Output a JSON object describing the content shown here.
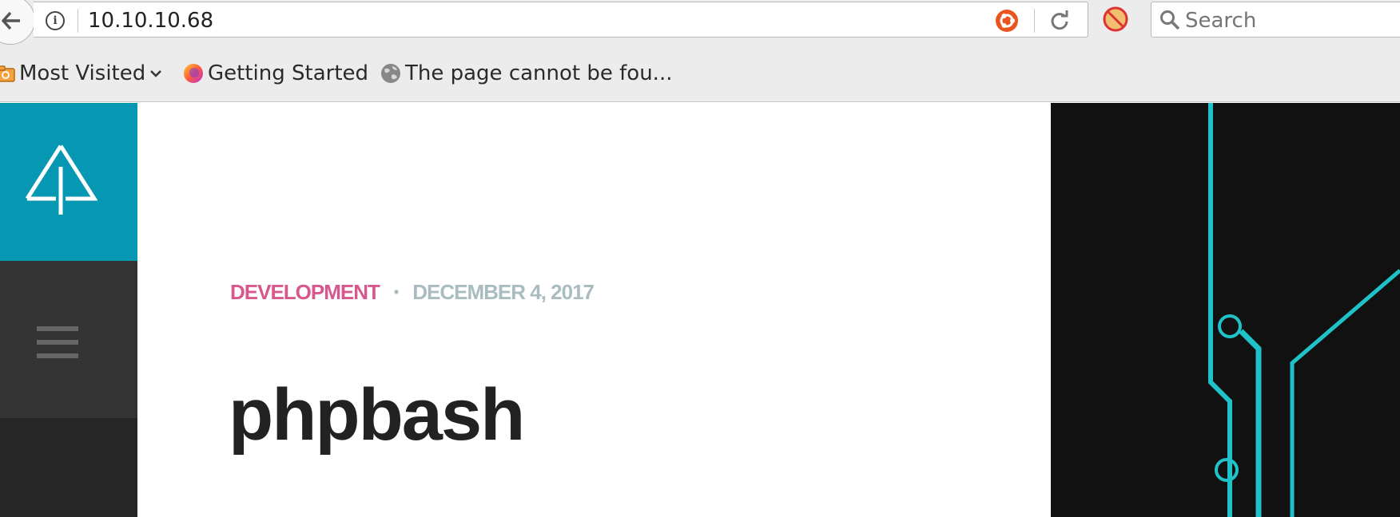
{
  "browser": {
    "url": "10.10.10.68",
    "search_placeholder": "Search",
    "bookmarks": [
      {
        "label": "Most Visited",
        "icon": "folder-icon"
      },
      {
        "label": "Getting Started",
        "icon": "firefox-icon"
      },
      {
        "label": "The page cannot be fou...",
        "icon": "globe-icon"
      }
    ]
  },
  "page": {
    "category": "DEVELOPMENT",
    "separator": "•",
    "date": "DECEMBER 4, 2017",
    "title": "phpbash"
  },
  "colors": {
    "sidebar_accent": "#0697b3",
    "category": "#d8588e",
    "date": "#a9bdc0",
    "circuit": "#1fc2c8"
  }
}
